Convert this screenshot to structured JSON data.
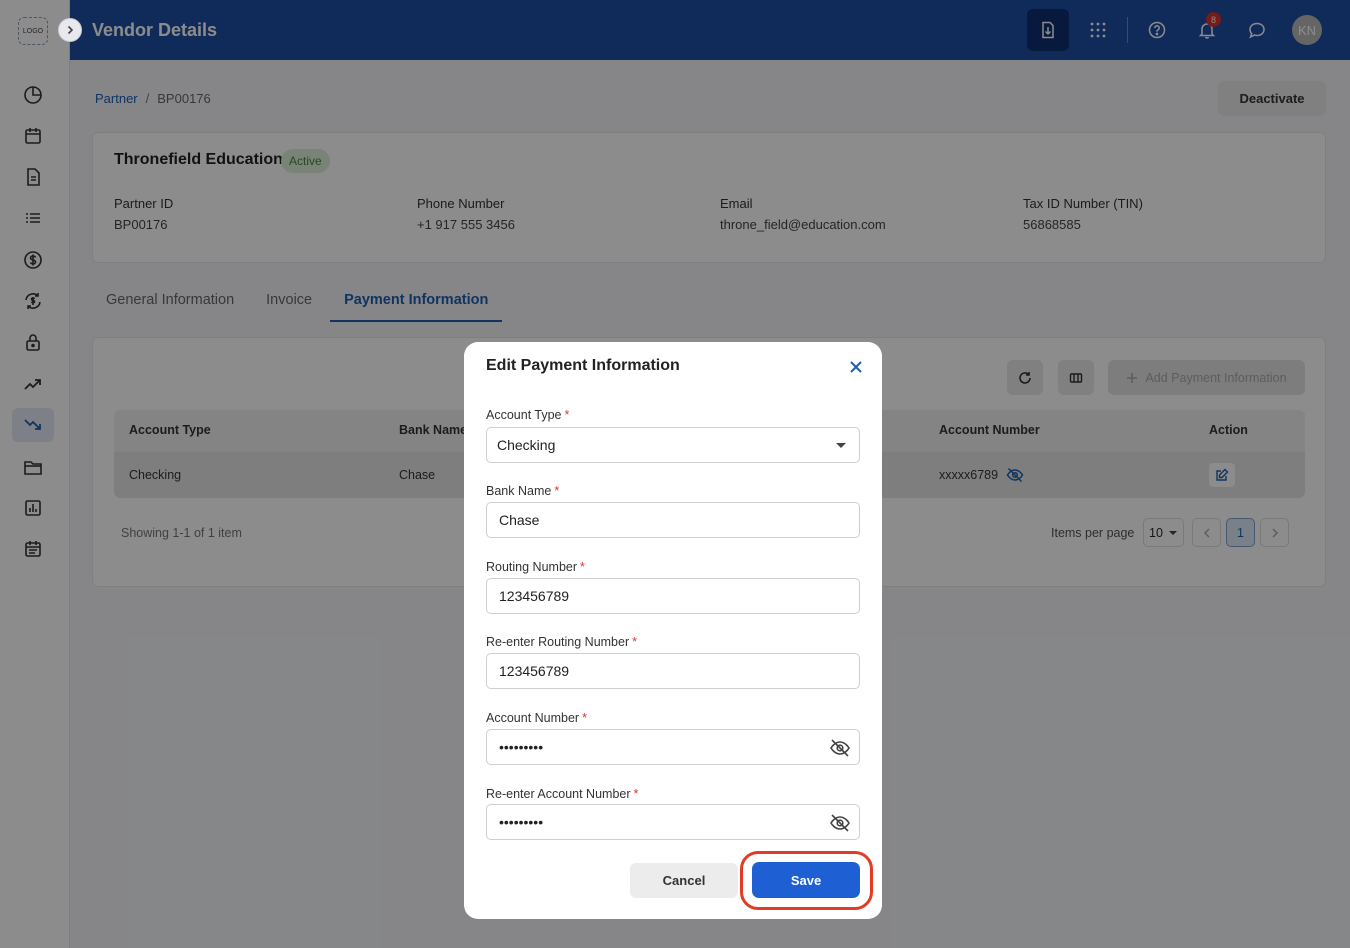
{
  "header": {
    "title": "Vendor Details",
    "notification_count": "8",
    "avatar_initials": "KN"
  },
  "sidebar": {
    "logo_text": "LOGO",
    "items": [
      "pie-chart-icon",
      "calendar-icon",
      "document-icon",
      "list-icon",
      "dollar-icon",
      "exchange-icon",
      "lock-icon",
      "trending-up-icon",
      "trending-down-icon",
      "folder-icon",
      "report-icon",
      "calendar-list-icon"
    ],
    "active_item": "trending-down-icon"
  },
  "breadcrumb": {
    "parent": "Partner",
    "separator": "/",
    "current": "BP00176"
  },
  "deactivate_label": "Deactivate",
  "partner": {
    "name": "Thronefield Education",
    "status": "Active",
    "fields": [
      {
        "label": "Partner ID",
        "value": "BP00176"
      },
      {
        "label": "Phone Number",
        "value": "+1 917 555 3456"
      },
      {
        "label": "Email",
        "value": "throne_field@education.com"
      },
      {
        "label": "Tax ID Number (TIN)",
        "value": "56868585"
      }
    ]
  },
  "tabs": [
    "General Information",
    "Invoice",
    "Payment Information"
  ],
  "active_tab": "Payment Information",
  "table": {
    "add_button": "Add Payment Information",
    "columns": [
      "Account Type",
      "Bank Name",
      "Account Number",
      "Action"
    ],
    "rows": [
      {
        "account_type": "Checking",
        "bank_name": "Chase",
        "account_number": "xxxxx6789"
      }
    ],
    "showing": "Showing 1-1 of 1 item",
    "items_per_page_label": "Items per page",
    "items_per_page": "10",
    "current_page": "1"
  },
  "modal": {
    "title": "Edit Payment Information",
    "fields": [
      {
        "label": "Account Type",
        "value": "Checking",
        "type": "select"
      },
      {
        "label": "Bank Name",
        "value": "Chase",
        "type": "text"
      },
      {
        "label": "Routing Number",
        "value": "123456789",
        "type": "text"
      },
      {
        "label": "Re-enter Routing Number",
        "value": "123456789",
        "type": "text"
      },
      {
        "label": "Account Number",
        "value": "•••••••••",
        "type": "password"
      },
      {
        "label": "Re-enter Account Number",
        "value": "•••••••••",
        "type": "password"
      }
    ],
    "required_mark": "*",
    "cancel_label": "Cancel",
    "save_label": "Save"
  },
  "colors": {
    "header": "#1e4fa5",
    "primary": "#1e5fd4",
    "highlight": "#e23d24"
  }
}
